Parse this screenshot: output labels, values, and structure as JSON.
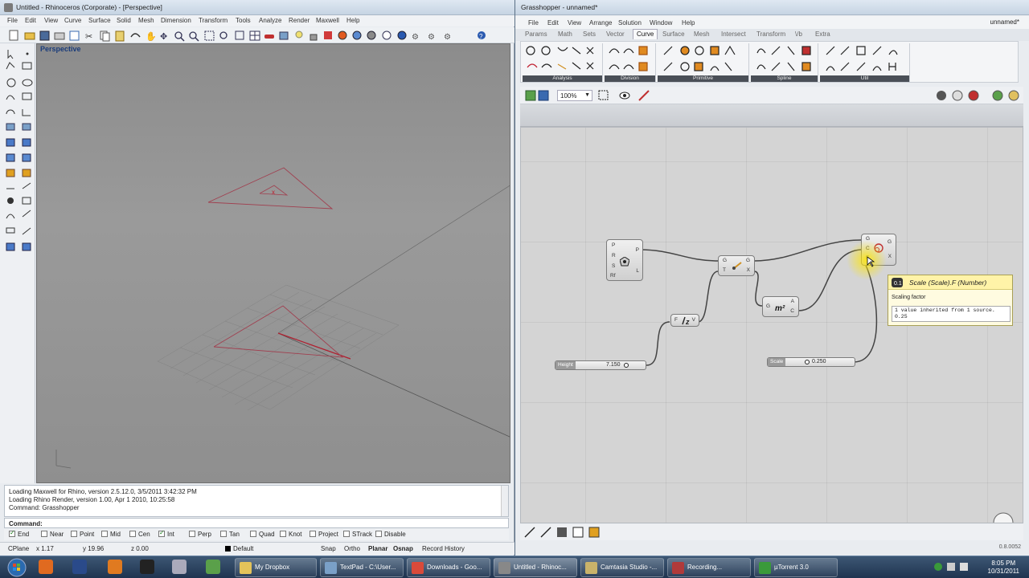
{
  "rhino": {
    "title": "Untitled - Rhinoceros (Corporate) - [Perspective]",
    "menu": [
      "File",
      "Edit",
      "View",
      "Curve",
      "Surface",
      "Solid",
      "Mesh",
      "Dimension",
      "Transform",
      "Tools",
      "Analyze",
      "Render",
      "Maxwell",
      "Help"
    ],
    "viewport_label": "Perspective",
    "history": [
      "Loading Maxwell for Rhino, version 2.5.12.0, 3/5/2011 3:42:32 PM",
      "Loading Rhino Render, version 1.00, Apr  1 2010, 10:25:58",
      "Command: Grasshopper"
    ],
    "command_label": "Command:",
    "osnaps": [
      {
        "label": "End",
        "checked": true
      },
      {
        "label": "Near",
        "checked": false
      },
      {
        "label": "Point",
        "checked": false
      },
      {
        "label": "Mid",
        "checked": false
      },
      {
        "label": "Cen",
        "checked": false
      },
      {
        "label": "Int",
        "checked": true
      },
      {
        "label": "Perp",
        "checked": false
      },
      {
        "label": "Tan",
        "checked": false
      },
      {
        "label": "Quad",
        "checked": false
      },
      {
        "label": "Knot",
        "checked": false
      },
      {
        "label": "Project",
        "checked": false
      },
      {
        "label": "STrack",
        "checked": false
      },
      {
        "label": "Disable",
        "checked": false
      }
    ],
    "status": {
      "cplane": "CPlane",
      "x": "x 1.17",
      "y": "y 19.96",
      "z": "z 0.00",
      "layer": "Default",
      "toggles": [
        "Snap",
        "Ortho",
        "Planar",
        "Osnap",
        "Record History"
      ]
    }
  },
  "gh": {
    "title": "Grasshopper - unnamed*",
    "menu": [
      "File",
      "Edit",
      "View",
      "Arrange",
      "Solution",
      "Window",
      "Help"
    ],
    "doc_name": "unnamed*",
    "tabs": [
      "Params",
      "Math",
      "Sets",
      "Vector",
      "Curve",
      "Surface",
      "Mesh",
      "Intersect",
      "Transform",
      "\\/b",
      "Extra"
    ],
    "active_tab": "Curve",
    "ribbon_groups": [
      "Analysis",
      "Division",
      "Primitive",
      "Spline",
      "Util"
    ],
    "zoom": "100%",
    "components": {
      "polygon": {
        "inputs": [
          "P",
          "R",
          "S",
          "Rf"
        ],
        "outputs": [
          "P",
          "L"
        ]
      },
      "move": {
        "inputs": [
          "G",
          "T"
        ],
        "outputs": [
          "G",
          "X"
        ]
      },
      "unitz": {
        "inputs": [
          "F"
        ],
        "outputs": [
          "V"
        ]
      },
      "area": {
        "inputs": [
          "G"
        ],
        "outputs": [
          "A",
          "C"
        ]
      },
      "scale": {
        "inputs": [
          "G",
          "C",
          "F"
        ],
        "outputs": [
          "G",
          "X"
        ]
      }
    },
    "sliders": [
      {
        "name": "Height",
        "value": "7.150"
      },
      {
        "name": "Scale",
        "value": "0.250"
      }
    ],
    "tooltip": {
      "title": "Scale (Scale).F (Number)",
      "description": "Scaling factor",
      "detail": "1 value inherited from 1 source.\n0.25"
    },
    "version": "0.8.0052"
  },
  "taskbar": {
    "windows": [
      {
        "label": "My Dropbox",
        "color": "#e4c35a"
      },
      {
        "label": "TextPad - C:\\User...",
        "color": "#7aa0c8"
      },
      {
        "label": "Downloads - Goo...",
        "color": "#d94a3a"
      },
      {
        "label": "Untitled - Rhinoc...",
        "color": "#888888"
      },
      {
        "label": "Camtasia Studio -...",
        "color": "#c9b36a"
      },
      {
        "label": "Recording...",
        "color": "#b03a3a"
      },
      {
        "label": "µTorrent 3.0",
        "color": "#3a9a3a"
      }
    ],
    "time": "8:05 PM",
    "date": "10/31/2011"
  },
  "colors": {
    "accent": "#1a3c7a",
    "tooltip_bg": "#fffbe0",
    "curve_red": "#c02030"
  }
}
